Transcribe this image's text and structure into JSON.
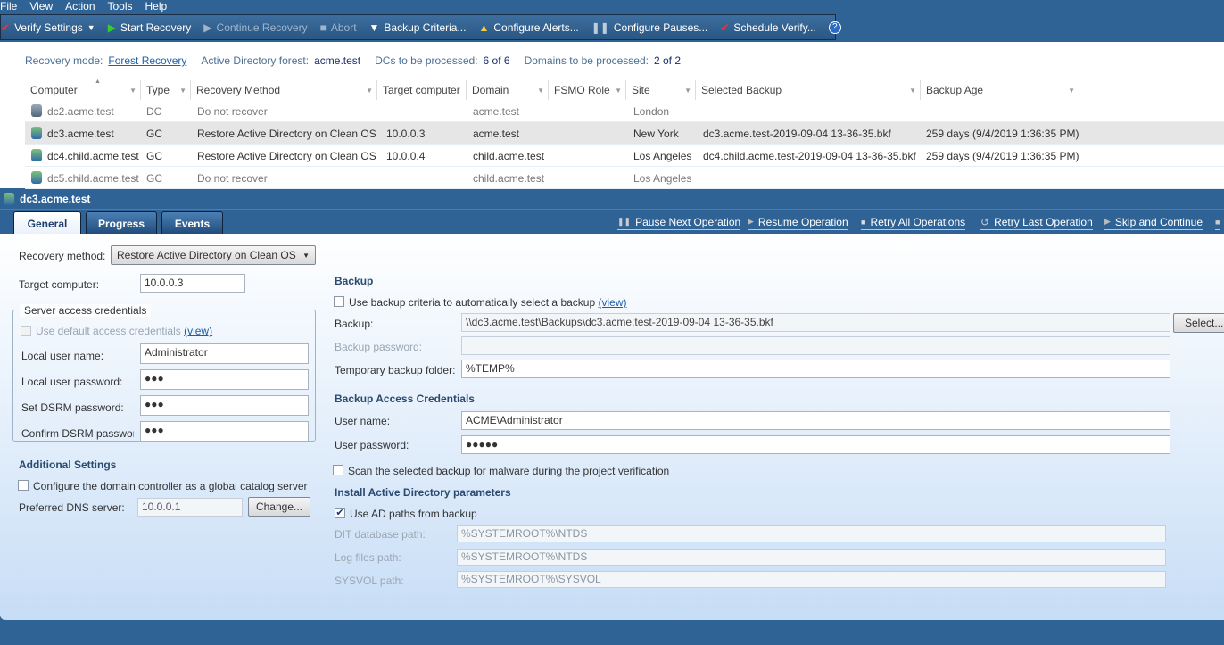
{
  "menu": [
    "File",
    "View",
    "Action",
    "Tools",
    "Help"
  ],
  "toolbar": {
    "verify_settings": "Verify Settings",
    "start_recovery": "Start Recovery",
    "continue_recovery": "Continue Recovery",
    "abort": "Abort",
    "backup_criteria": "Backup Criteria...",
    "configure_alerts": "Configure Alerts...",
    "configure_pauses": "Configure Pauses...",
    "schedule_verify": "Schedule Verify...",
    "help": "?"
  },
  "info": {
    "recovery_mode_label": "Recovery mode:",
    "recovery_mode": "Forest Recovery",
    "forest_label": "Active Directory forest:",
    "forest": "acme.test",
    "dcs_label": "DCs to be processed:",
    "dcs": "6 of 6",
    "domains_label": "Domains to be processed:",
    "domains": "2 of 2"
  },
  "grid": {
    "columns": [
      "Computer",
      "Type",
      "Recovery Method",
      "Target computer",
      "Domain",
      "FSMO Role",
      "Site",
      "Selected Backup",
      "Backup Age"
    ],
    "rows": [
      {
        "computer": "dc2.acme.test",
        "type": "DC",
        "method": "Do not recover",
        "target": "",
        "domain": "acme.test",
        "fsmo": "",
        "site": "London",
        "backup": "",
        "age": ""
      },
      {
        "computer": "dc3.acme.test",
        "type": "GC",
        "method": "Restore Active Directory on Clean OS",
        "target": "10.0.0.3",
        "domain": "acme.test",
        "fsmo": "",
        "site": "New York",
        "backup": "dc3.acme.test-2019-09-04 13-36-35.bkf",
        "age": "259 days (9/4/2019 1:36:35 PM)"
      },
      {
        "computer": "dc4.child.acme.test",
        "type": "GC",
        "method": "Restore Active Directory on Clean OS",
        "target": "10.0.0.4",
        "domain": "child.acme.test",
        "fsmo": "",
        "site": "Los Angeles",
        "backup": "dc4.child.acme.test-2019-09-04 13-36-35.bkf",
        "age": "259 days (9/4/2019 1:36:35 PM)"
      },
      {
        "computer": "dc5.child.acme.test",
        "type": "GC",
        "method": "Do not recover",
        "target": "",
        "domain": "child.acme.test",
        "fsmo": "",
        "site": "Los Angeles",
        "backup": "",
        "age": ""
      }
    ]
  },
  "details": {
    "title": "dc3.acme.test",
    "tabs": [
      "General",
      "Progress",
      "Events"
    ],
    "ops": [
      "Pause Next Operation",
      "Resume Operation",
      "Retry All Operations",
      "Retry Last Operation",
      "Skip and Continue"
    ]
  },
  "general": {
    "recovery_method_label": "Recovery method:",
    "recovery_method": "Restore Active Directory on Clean OS",
    "target_label": "Target computer:",
    "target": "10.0.0.3",
    "server_creds_legend": "Server access credentials",
    "use_default_creds": "Use default access credentials",
    "view": "(view)",
    "local_user_label": "Local user name:",
    "local_user": "Administrator",
    "local_pwd_label": "Local user password:",
    "local_pwd": "●●●",
    "dsrm_label": "Set DSRM password:",
    "dsrm": "●●●",
    "confirm_dsrm_label": "Confirm DSRM passwor",
    "confirm_dsrm": "●●●",
    "additional_settings": "Additional Settings",
    "gc_checkbox": "Configure the domain controller as a global catalog server",
    "dns_label": "Preferred DNS server:",
    "dns": "10.0.0.1",
    "change": "Change...",
    "backup_heading": "Backup",
    "use_criteria": "Use backup criteria to automatically select a backup",
    "backup_label": "Backup:",
    "backup": "\\\\dc3.acme.test\\Backups\\dc3.acme.test-2019-09-04 13-36-35.bkf",
    "select": "Select...",
    "backup_pwd_label": "Backup password:",
    "backup_pwd": "",
    "temp_label": "Temporary backup folder:",
    "temp": "%TEMP%",
    "bac_heading": "Backup Access Credentials",
    "user_label": "User name:",
    "user": "ACME\\Administrator",
    "user_pwd_label": "User password:",
    "user_pwd": "●●●●●",
    "scan": "Scan the selected backup for malware during the project verification",
    "install_heading": "Install Active Directory parameters",
    "use_ad_paths": "Use AD paths from backup",
    "dit_label": "DIT database path:",
    "dit": "%SYSTEMROOT%\\NTDS",
    "log_label": "Log files path:",
    "log": "%SYSTEMROOT%\\NTDS",
    "sysvol_label": "SYSVOL path:",
    "sysvol": "%SYSTEMROOT%\\SYSVOL"
  }
}
